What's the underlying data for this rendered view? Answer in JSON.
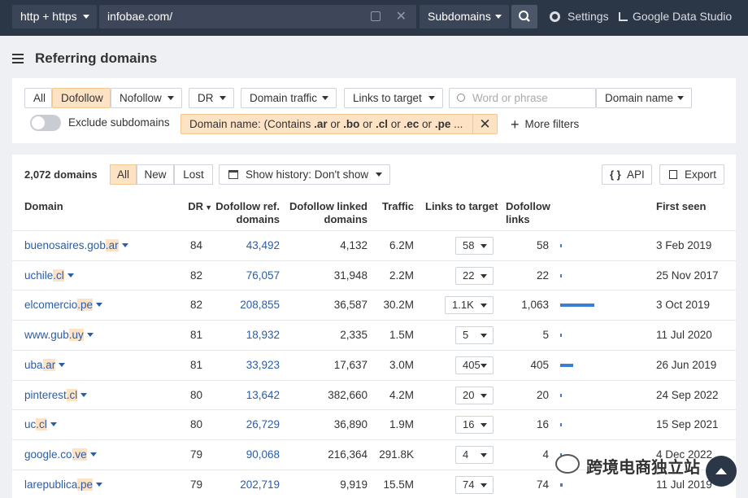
{
  "topbar": {
    "protocol": "http + https",
    "url": "infobae.com/",
    "mode": "Subdomains",
    "settings": "Settings",
    "gds": "Google Data Studio"
  },
  "page": {
    "title": "Referring domains"
  },
  "filters": {
    "all": "All",
    "dofollow": "Dofollow",
    "nofollow": "Nofollow",
    "dr": "DR",
    "domain_traffic": "Domain traffic",
    "links_to_target": "Links to target",
    "search_placeholder": "Word or phrase",
    "domain_name": "Domain name",
    "exclude_subdomains": "Exclude subdomains",
    "chip_prefix": "Domain name: (Contains ",
    "chip_terms": [
      ".ar",
      ".bo",
      ".cl",
      ".ec",
      ".pe"
    ],
    "chip_or": "or",
    "chip_suffix": "...",
    "more_filters": "More filters"
  },
  "results": {
    "count": "2,072 domains",
    "seg_all": "All",
    "seg_new": "New",
    "seg_lost": "Lost",
    "history": "Show history: Don't show",
    "api": "API",
    "export": "Export"
  },
  "table": {
    "headers": {
      "domain": "Domain",
      "dr": "DR",
      "dofollow_ref_1": "Dofollow ref.",
      "dofollow_ref_2": "domains",
      "linked_1": "Dofollow linked",
      "linked_2": "domains",
      "traffic": "Traffic",
      "ltt": "Links to target",
      "dflinks_1": "Dofollow",
      "dflinks_2": "links",
      "first_seen": "First seen"
    },
    "rows": [
      {
        "base": "buenosaires.gob",
        "tld": ".ar",
        "dr": "84",
        "ref": "43,492",
        "linked": "4,132",
        "traffic": "6.2M",
        "ltt": "58",
        "dflinks": "58",
        "links_value": 58,
        "first_seen": "3 Feb 2019"
      },
      {
        "base": "uchile",
        "tld": ".cl",
        "dr": "82",
        "ref": "76,057",
        "linked": "31,948",
        "traffic": "2.2M",
        "ltt": "22",
        "dflinks": "22",
        "links_value": 22,
        "first_seen": "25 Nov 2017"
      },
      {
        "base": "elcomercio",
        "tld": ".pe",
        "dr": "82",
        "ref": "208,855",
        "linked": "36,587",
        "traffic": "30.2M",
        "ltt": "1.1K",
        "dflinks": "1,063",
        "links_value": 1063,
        "first_seen": "3 Oct 2019"
      },
      {
        "base": "www.gub",
        "tld": ".uy",
        "dr": "81",
        "ref": "18,932",
        "linked": "2,335",
        "traffic": "1.5M",
        "ltt": "5",
        "dflinks": "5",
        "links_value": 5,
        "first_seen": "11 Jul 2020"
      },
      {
        "base": "uba",
        "tld": ".ar",
        "dr": "81",
        "ref": "33,923",
        "linked": "17,637",
        "traffic": "3.0M",
        "ltt": "405",
        "dflinks": "405",
        "links_value": 405,
        "first_seen": "26 Jun 2019"
      },
      {
        "base": "pinterest",
        "tld": ".cl",
        "dr": "80",
        "ref": "13,642",
        "linked": "382,660",
        "traffic": "4.2M",
        "ltt": "20",
        "dflinks": "20",
        "links_value": 20,
        "first_seen": "24 Sep 2022"
      },
      {
        "base": "uc",
        "tld": ".cl",
        "dr": "80",
        "ref": "26,729",
        "linked": "36,890",
        "traffic": "1.9M",
        "ltt": "16",
        "dflinks": "16",
        "links_value": 16,
        "first_seen": "15 Sep 2021"
      },
      {
        "base": "google.co",
        "tld": ".ve",
        "dr": "79",
        "ref": "90,068",
        "linked": "216,364",
        "traffic": "291.8K",
        "ltt": "4",
        "dflinks": "4",
        "links_value": 4,
        "first_seen": "4 Dec 2022"
      },
      {
        "base": "larepublica",
        "tld": ".pe",
        "dr": "79",
        "ref": "202,719",
        "linked": "9,919",
        "traffic": "15.5M",
        "ltt": "74",
        "dflinks": "74",
        "links_value": 74,
        "first_seen": "11 Jul 2019"
      }
    ]
  },
  "watermark": {
    "text": "跨境电商独立站"
  },
  "colors": {
    "topbar": "#2b3647",
    "accent": "#fde3c3",
    "link": "#2a5da8",
    "bar": "#3a7fd1"
  }
}
